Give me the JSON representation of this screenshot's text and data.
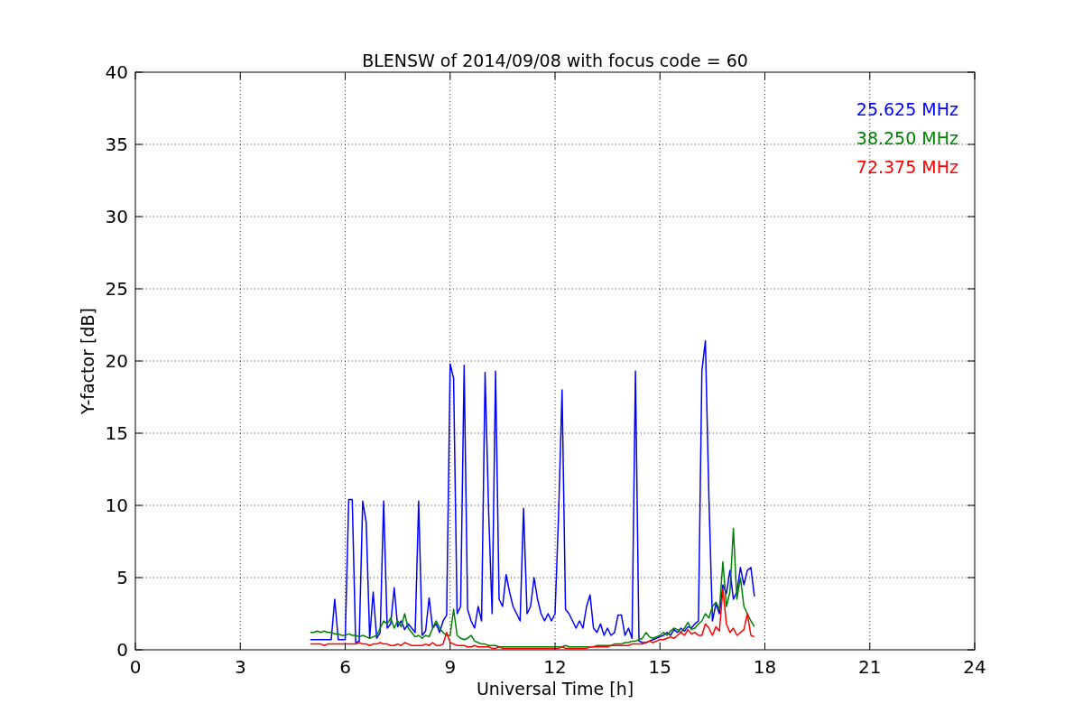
{
  "chart_data": {
    "type": "line",
    "title": "BLENSW of 2014/09/08 with focus code = 60",
    "xlabel": "Universal Time [h]",
    "ylabel": "Y-factor [dB]",
    "x": [
      5,
      5.1,
      5.2,
      5.3,
      5.4,
      5.5,
      5.6,
      5.7,
      5.8,
      5.9,
      6,
      6.1,
      6.2,
      6.3,
      6.4,
      6.5,
      6.6,
      6.7,
      6.8,
      6.9,
      7,
      7.1,
      7.2,
      7.3,
      7.4,
      7.5,
      7.6,
      7.7,
      7.8,
      7.9,
      8,
      8.1,
      8.2,
      8.3,
      8.4,
      8.5,
      8.6,
      8.7,
      8.8,
      8.9,
      9,
      9.1,
      9.2,
      9.3,
      9.4,
      9.5,
      9.6,
      9.7,
      9.8,
      9.9,
      10,
      10.1,
      10.2,
      10.3,
      10.4,
      10.5,
      10.6,
      10.7,
      10.8,
      10.9,
      11,
      11.1,
      11.2,
      11.3,
      11.4,
      11.5,
      11.6,
      11.7,
      11.8,
      11.9,
      12,
      12.1,
      12.2,
      12.3,
      12.4,
      12.5,
      12.6,
      12.7,
      12.8,
      12.9,
      13,
      13.1,
      13.2,
      13.3,
      13.4,
      13.5,
      13.6,
      13.7,
      13.8,
      13.9,
      14,
      14.1,
      14.2,
      14.3,
      14.4,
      14.5,
      14.6,
      14.7,
      14.8,
      14.9,
      15,
      15.1,
      15.2,
      15.3,
      15.4,
      15.5,
      15.6,
      15.7,
      15.8,
      15.9,
      16,
      16.1,
      16.2,
      16.3,
      16.4,
      16.5,
      16.6,
      16.7,
      16.8,
      16.9,
      17,
      17.1,
      17.2,
      17.3,
      17.4,
      17.5,
      17.6,
      17.7
    ],
    "series": [
      {
        "name": "25.625 MHz",
        "color": "#0000ff",
        "values": [
          0.7,
          0.7,
          0.7,
          0.7,
          0.7,
          0.7,
          0.7,
          3.5,
          0.7,
          0.7,
          0.7,
          10.4,
          10.4,
          0.5,
          0.6,
          10.3,
          8.8,
          0.8,
          4.0,
          0.8,
          1.2,
          10.3,
          1.5,
          1.8,
          4.3,
          1.6,
          2.0,
          1.4,
          1.8,
          1.5,
          1.2,
          10.3,
          1.0,
          1.3,
          3.6,
          1.5,
          1.8,
          1.2,
          2.0,
          2.4,
          19.8,
          18.8,
          2.5,
          3.0,
          19.7,
          2.8,
          2.0,
          1.5,
          3.0,
          2.0,
          19.2,
          9.6,
          2.5,
          19.3,
          3.5,
          3.0,
          5.2,
          4.0,
          3.0,
          2.5,
          2.0,
          9.8,
          2.5,
          3.0,
          5.0,
          3.5,
          2.5,
          2.0,
          2.5,
          2.0,
          2.5,
          9.3,
          18.0,
          2.8,
          2.5,
          2.0,
          1.5,
          2.0,
          1.5,
          3.0,
          3.8,
          1.5,
          1.2,
          1.8,
          1.0,
          1.5,
          1.0,
          1.2,
          2.4,
          2.4,
          1.0,
          1.5,
          0.8,
          19.3,
          0.6,
          0.5,
          0.5,
          0.6,
          0.7,
          0.8,
          0.9,
          1.0,
          1.2,
          1.0,
          1.4,
          1.2,
          1.5,
          1.3,
          1.6,
          1.5,
          1.8,
          2.0,
          19.3,
          21.4,
          10.5,
          2.0,
          3.2,
          2.5,
          4.5,
          3.9,
          5.5,
          3.5,
          4.0,
          5.7,
          4.5,
          5.5,
          5.7,
          3.7
        ]
      },
      {
        "name": "38.250 MHz",
        "color": "#008000",
        "values": [
          1.2,
          1.2,
          1.3,
          1.2,
          1.3,
          1.2,
          1.2,
          1.1,
          1.1,
          1.0,
          1.0,
          1.1,
          1.0,
          1.0,
          0.9,
          1.0,
          0.9,
          0.8,
          0.9,
          1.0,
          1.5,
          2.0,
          1.8,
          2.2,
          1.5,
          2.0,
          1.6,
          2.5,
          1.5,
          1.2,
          0.9,
          1.0,
          0.8,
          1.0,
          0.9,
          1.5,
          2.0,
          1.5,
          1.2,
          1.0,
          1.0,
          2.8,
          1.0,
          0.8,
          0.7,
          0.8,
          1.0,
          0.6,
          0.5,
          0.4,
          0.4,
          0.3,
          0.3,
          0.3,
          0.2,
          0.2,
          0.2,
          0.2,
          0.2,
          0.2,
          0.2,
          0.2,
          0.2,
          0.2,
          0.2,
          0.2,
          0.2,
          0.2,
          0.2,
          0.2,
          0.2,
          0.2,
          0.2,
          0.3,
          0.2,
          0.2,
          0.2,
          0.2,
          0.2,
          0.2,
          0.2,
          0.2,
          0.3,
          0.3,
          0.3,
          0.3,
          0.3,
          0.4,
          0.4,
          0.4,
          0.5,
          0.5,
          0.6,
          0.6,
          0.7,
          0.8,
          1.2,
          0.9,
          0.8,
          0.9,
          1.0,
          1.2,
          1.0,
          1.3,
          1.5,
          1.4,
          1.2,
          1.5,
          1.9,
          1.4,
          1.5,
          1.8,
          2.0,
          2.5,
          2.2,
          3.0,
          3.3,
          2.8,
          6.1,
          3.0,
          4.0,
          8.4,
          3.5,
          5.0,
          3.0,
          2.5,
          2.0,
          1.6
        ]
      },
      {
        "name": "72.375 MHz",
        "color": "#ff0000",
        "values": [
          0.4,
          0.4,
          0.4,
          0.4,
          0.3,
          0.4,
          0.4,
          0.4,
          0.4,
          0.4,
          0.4,
          0.4,
          0.4,
          0.4,
          0.5,
          0.4,
          0.4,
          0.3,
          0.4,
          0.4,
          0.5,
          0.4,
          0.4,
          0.3,
          0.3,
          0.4,
          0.3,
          0.5,
          0.4,
          0.3,
          0.3,
          0.3,
          0.3,
          0.4,
          0.3,
          0.5,
          0.3,
          0.3,
          0.4,
          1.2,
          0.5,
          0.4,
          0.3,
          0.3,
          0.3,
          0.2,
          0.2,
          0.3,
          0.2,
          0.2,
          0.2,
          0.2,
          0.1,
          0.1,
          0.2,
          0.1,
          0.1,
          0.1,
          0.1,
          0.1,
          0.1,
          0.1,
          0.1,
          0.1,
          0.1,
          0.1,
          0.1,
          0.1,
          0.1,
          0.1,
          0.1,
          0.1,
          0.2,
          0.1,
          0.1,
          0.1,
          0.1,
          0.1,
          0.1,
          0.1,
          0.2,
          0.2,
          0.2,
          0.2,
          0.2,
          0.2,
          0.3,
          0.3,
          0.3,
          0.3,
          0.3,
          0.3,
          0.4,
          0.4,
          0.4,
          0.4,
          0.5,
          0.6,
          0.5,
          0.6,
          0.7,
          0.7,
          0.8,
          0.9,
          0.8,
          1.0,
          1.2,
          1.0,
          1.4,
          1.1,
          1.2,
          1.0,
          1.0,
          1.8,
          1.5,
          1.0,
          1.6,
          1.3,
          4.2,
          1.8,
          1.2,
          1.5,
          1.0,
          1.2,
          1.4,
          2.5,
          1.0,
          0.9
        ]
      }
    ],
    "xlim": [
      0,
      24
    ],
    "ylim": [
      0,
      40
    ],
    "xticks": [
      0,
      3,
      6,
      9,
      12,
      15,
      18,
      21,
      24
    ],
    "yticks": [
      0,
      5,
      10,
      15,
      20,
      25,
      30,
      35,
      40
    ],
    "grid": true
  }
}
